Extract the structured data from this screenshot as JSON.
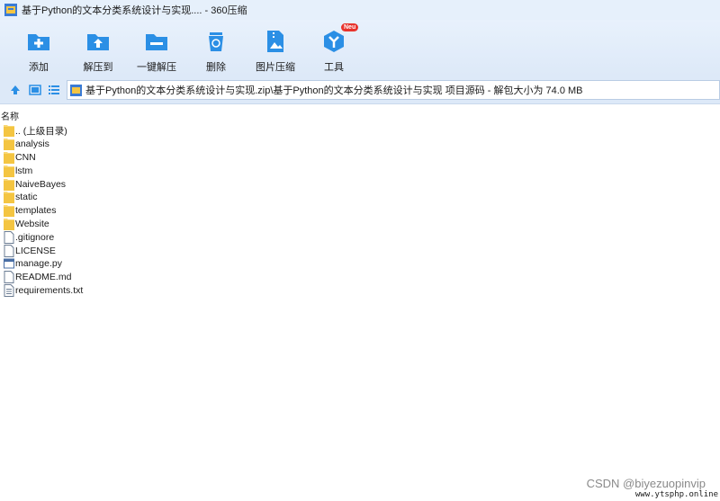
{
  "window": {
    "title": "基于Python的文本分类系统设计与实现.... - 360压缩"
  },
  "toolbar": {
    "items": [
      {
        "label": "添加",
        "icon": "add-icon"
      },
      {
        "label": "解压到",
        "icon": "extract-to-icon"
      },
      {
        "label": "一键解压",
        "icon": "one-click-extract-icon"
      },
      {
        "label": "删除",
        "icon": "delete-icon"
      },
      {
        "label": "图片压缩",
        "icon": "image-compress-icon"
      },
      {
        "label": "工具",
        "icon": "tools-icon",
        "badge": "Neu"
      }
    ]
  },
  "navbar": {
    "path": "基于Python的文本分类系统设计与实现.zip\\基于Python的文本分类系统设计与实现 项目源码 - 解包大小为 74.0 MB"
  },
  "columns": {
    "name": "名称"
  },
  "files": [
    {
      "name": ".. (上级目录)",
      "type": "folder"
    },
    {
      "name": "analysis",
      "type": "folder"
    },
    {
      "name": "CNN",
      "type": "folder"
    },
    {
      "name": "lstm",
      "type": "folder"
    },
    {
      "name": "NaiveBayes",
      "type": "folder"
    },
    {
      "name": "static",
      "type": "folder"
    },
    {
      "name": "templates",
      "type": "folder"
    },
    {
      "name": "Website",
      "type": "folder"
    },
    {
      "name": ".gitignore",
      "type": "file"
    },
    {
      "name": "LICENSE",
      "type": "file"
    },
    {
      "name": "manage.py",
      "type": "python"
    },
    {
      "name": "README.md",
      "type": "file"
    },
    {
      "name": "requirements.txt",
      "type": "text"
    }
  ],
  "watermark": {
    "csdn": "CSDN @biyezuopinvip",
    "site": "www.ytsphp.online"
  },
  "colors": {
    "accent": "#2b8fe5",
    "folder": "#f8d775",
    "badge": "#e8342d"
  }
}
